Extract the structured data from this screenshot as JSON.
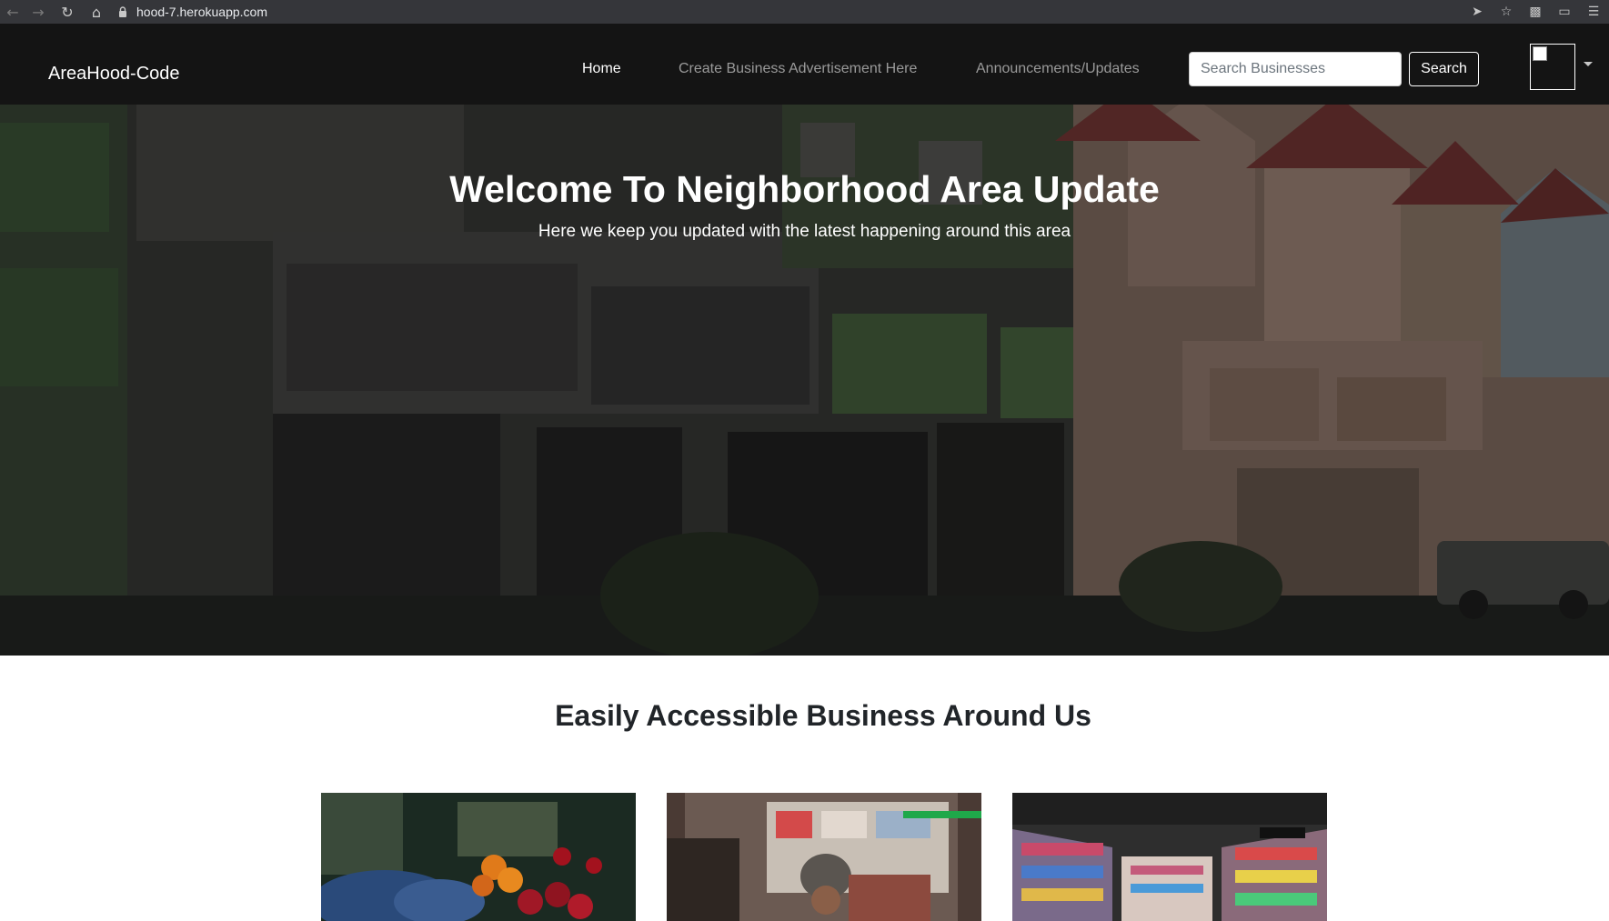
{
  "browser": {
    "url": "hood-7.herokuapp.com",
    "icons": [
      "back-icon",
      "forward-icon",
      "reload-icon",
      "home-icon",
      "lock-icon",
      "send-icon",
      "star-icon",
      "extensions-icon",
      "cast-icon",
      "media-icon"
    ]
  },
  "navbar": {
    "brand": "AreaHood-Code",
    "links": [
      {
        "label": "Home",
        "active": true
      },
      {
        "label": "Create Business Advertisement Here",
        "active": false
      },
      {
        "label": "Announcements/Updates",
        "active": false
      }
    ],
    "search": {
      "placeholder": "Search Businesses",
      "value": "",
      "button_label": "Search"
    }
  },
  "hero": {
    "title": "Welcome To Neighborhood Area Update",
    "subtitle": "Here we keep you updated with the latest happening around this area"
  },
  "section": {
    "title": "Easily Accessible Business Around Us",
    "cards": [
      {
        "image": "fruit-market-image"
      },
      {
        "image": "salon-shop-image"
      },
      {
        "image": "grocery-aisle-image"
      }
    ]
  },
  "colors": {
    "navbar_bg": "#141414",
    "chrome_bg": "#35363a",
    "nav_link_muted": "#9a9a9a"
  }
}
